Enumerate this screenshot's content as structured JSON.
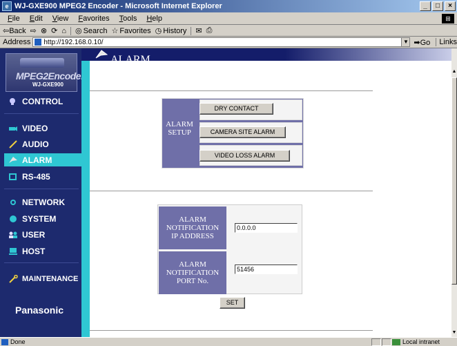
{
  "window": {
    "title": "WJ-GXE900 MPEG2 Encoder - Microsoft Internet Explorer",
    "controls": [
      "_",
      "□",
      "×"
    ]
  },
  "menubar": {
    "items": [
      "File",
      "Edit",
      "View",
      "Favorites",
      "Tools",
      "Help"
    ]
  },
  "toolbar": {
    "back_label": "⇦Back",
    "forward_label": "⇨",
    "search_label": "Search",
    "favorites_label": "Favorites",
    "history_label": "History"
  },
  "addressbar": {
    "label": "Address",
    "url": "http://192.168.0.10/",
    "go_label": "Go",
    "links_label": "Links"
  },
  "sidebar": {
    "logo_line1": "MPEG2Encoder",
    "logo_line2": "WJ-GXE900",
    "items": [
      {
        "label": "CONTROL",
        "icon": "bulb-icon"
      },
      {
        "label": "VIDEO",
        "icon": "camera-icon"
      },
      {
        "label": "AUDIO",
        "icon": "pen-icon"
      },
      {
        "label": "ALARM",
        "icon": "arrow-icon",
        "active": true
      },
      {
        "label": "RS-485",
        "icon": "screen-icon"
      },
      {
        "label": "NETWORK",
        "icon": "network-icon"
      },
      {
        "label": "SYSTEM",
        "icon": "globe-icon"
      },
      {
        "label": "USER",
        "icon": "users-icon"
      },
      {
        "label": "HOST",
        "icon": "computer-icon"
      },
      {
        "label": "MAINTENANCE",
        "icon": "wrench-icon"
      }
    ],
    "brand": "Panasonic"
  },
  "header": {
    "title": "ALARM"
  },
  "alarm_setup": {
    "label_line1": "ALARM",
    "label_line2": "SETUP",
    "buttons": [
      "DRY CONTACT",
      "CAMERA SITE ALARM",
      "VIDEO LOSS ALARM"
    ]
  },
  "notification": {
    "ip_label_lines": [
      "ALARM",
      "NOTIFICATION",
      "IP ADDRESS"
    ],
    "ip_value": "0.0.0.0",
    "port_label_lines": [
      "ALARM",
      "NOTIFICATION",
      "PORT No."
    ],
    "port_value": "51456",
    "set_label": "SET"
  },
  "statusbar": {
    "status": "Done",
    "zone": "Local intranet"
  },
  "colors": {
    "sidebar": "#1d2a6e",
    "accent": "#2fc7d3",
    "label_bg": "#6f6fa8",
    "header_dark": "#141d6a"
  }
}
